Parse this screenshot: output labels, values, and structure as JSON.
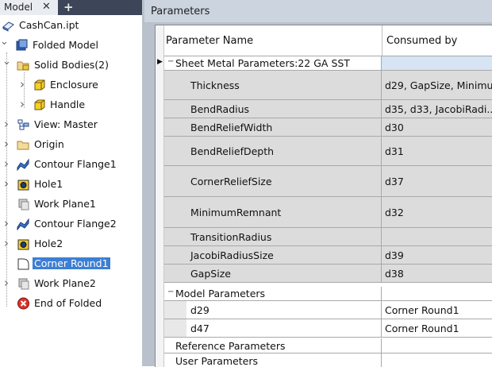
{
  "browser": {
    "tab_label": "Model",
    "tab_close": "✕",
    "tab_add": "+",
    "items": [
      {
        "label": "CashCan.ipt",
        "icon": "part-file-icon",
        "depth": 0,
        "expander": ""
      },
      {
        "label": "Folded Model",
        "icon": "folded-model-icon",
        "depth": 0,
        "expander": "v"
      },
      {
        "label": "Solid Bodies(2)",
        "icon": "solid-bodies-folder-icon",
        "depth": 1,
        "expander": "v"
      },
      {
        "label": "Enclosure",
        "icon": "solid-body-icon",
        "depth": 2,
        "expander": ">"
      },
      {
        "label": "Handle",
        "icon": "solid-body-icon",
        "depth": 2,
        "expander": ">"
      },
      {
        "label": "View: Master",
        "icon": "view-rep-icon",
        "depth": 1,
        "expander": ">"
      },
      {
        "label": "Origin",
        "icon": "origin-folder-icon",
        "depth": 1,
        "expander": ">"
      },
      {
        "label": "Contour Flange1",
        "icon": "contour-flange-icon",
        "depth": 1,
        "expander": ">"
      },
      {
        "label": "Hole1",
        "icon": "hole-icon",
        "depth": 1,
        "expander": ">"
      },
      {
        "label": "Work Plane1",
        "icon": "work-plane-icon",
        "depth": 1,
        "expander": ""
      },
      {
        "label": "Contour Flange2",
        "icon": "contour-flange-icon",
        "depth": 1,
        "expander": ">"
      },
      {
        "label": "Hole2",
        "icon": "hole-icon",
        "depth": 1,
        "expander": ">"
      },
      {
        "label": "Corner Round1",
        "icon": "corner-round-icon",
        "depth": 1,
        "expander": "",
        "selected": true
      },
      {
        "label": "Work Plane2",
        "icon": "work-plane-icon",
        "depth": 1,
        "expander": ">"
      },
      {
        "label": "End of Folded",
        "icon": "end-of-part-icon",
        "depth": 1,
        "expander": ""
      }
    ]
  },
  "dialog": {
    "title": "Parameters",
    "columns": {
      "name": "Parameter Name",
      "consumed": "Consumed by"
    },
    "groups": {
      "sheet_metal": {
        "label": "Sheet Metal Parameters:22 GA SST",
        "expander": "−"
      },
      "model": {
        "label": "Model Parameters",
        "expander": "−"
      },
      "reference": {
        "label": "Reference Parameters"
      },
      "user": {
        "label": "User Parameters"
      }
    },
    "sheet_metal_rows": [
      {
        "name": "Thickness",
        "consumed": "d29, GapSize, Minimu..."
      },
      {
        "name": "BendRadius",
        "consumed": "d35, d33, JacobiRadi..."
      },
      {
        "name": "BendReliefWidth",
        "consumed": "d30"
      },
      {
        "name": "BendReliefDepth",
        "consumed": "d31"
      },
      {
        "name": "CornerReliefSize",
        "consumed": "d37"
      },
      {
        "name": "MinimumRemnant",
        "consumed": "d32"
      },
      {
        "name": "TransitionRadius",
        "consumed": ""
      },
      {
        "name": "JacobiRadiusSize",
        "consumed": "d39"
      },
      {
        "name": "GapSize",
        "consumed": "d38"
      }
    ],
    "model_rows": [
      {
        "name": "d29",
        "consumed": "Corner Round1"
      },
      {
        "name": "d47",
        "consumed": "Corner Round1"
      }
    ],
    "row_pointer": "▶"
  },
  "colors": {
    "selection": "#3d7fd3",
    "tab_bar": "#3c4658",
    "dialog_frame": "#b9c1cc",
    "row_gray": "#dcdcdc"
  }
}
